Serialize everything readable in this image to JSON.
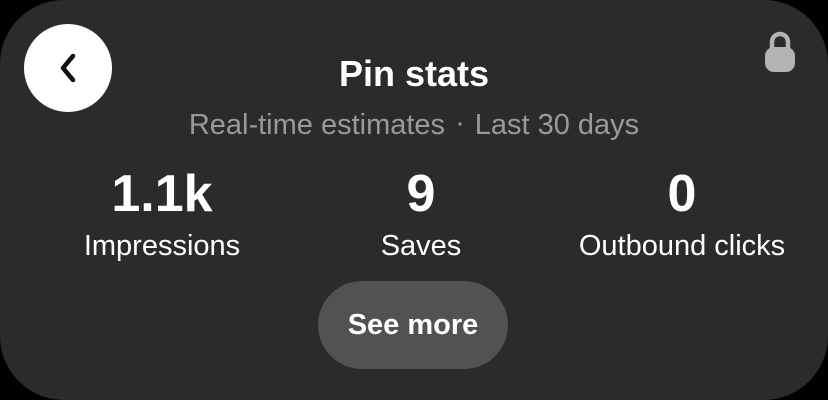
{
  "header": {
    "title": "Pin stats",
    "back_icon": "chevron-left-icon",
    "lock_icon": "lock-icon"
  },
  "subtitle": {
    "left": "Real-time estimates",
    "separator": "·",
    "right": "Last 30 days"
  },
  "stats": {
    "impressions": {
      "value": "1.1k",
      "label": "Impressions"
    },
    "saves": {
      "value": "9",
      "label": "Saves"
    },
    "outbound_clicks": {
      "value": "0",
      "label": "Outbound clicks"
    }
  },
  "actions": {
    "see_more_label": "See more"
  },
  "colors": {
    "card_background": "#2b2b2b",
    "text_primary": "#ffffff",
    "text_secondary": "#9a9a9a",
    "button_background": "#525252",
    "back_button_background": "#ffffff",
    "lock_icon": "#b3b3b3"
  }
}
